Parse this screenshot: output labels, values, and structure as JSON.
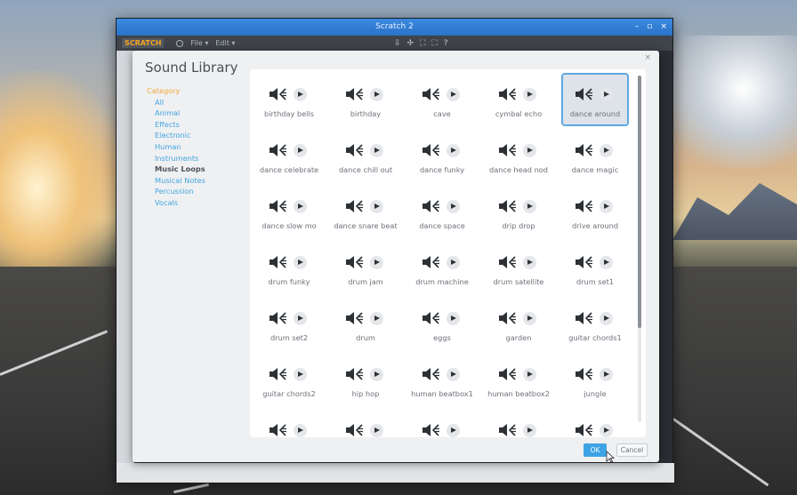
{
  "window": {
    "title": "Scratch 2",
    "controls": [
      "–",
      "▫",
      "×"
    ]
  },
  "menubar": {
    "logo": "SCRATCH",
    "items": [
      "File ▾",
      "Edit ▾"
    ],
    "toolbar_icons": [
      "⇩",
      "✢",
      "⛶",
      "⛶",
      "?"
    ]
  },
  "dialog": {
    "title": "Sound Library",
    "close": "×",
    "category_header": "Category",
    "categories": [
      {
        "label": "All",
        "selected": false
      },
      {
        "label": "Animal",
        "selected": false
      },
      {
        "label": "Effects",
        "selected": false
      },
      {
        "label": "Electronic",
        "selected": false
      },
      {
        "label": "Human",
        "selected": false
      },
      {
        "label": "Instruments",
        "selected": false
      },
      {
        "label": "Music Loops",
        "selected": true
      },
      {
        "label": "Musical Notes",
        "selected": false
      },
      {
        "label": "Percussion",
        "selected": false
      },
      {
        "label": "Vocals",
        "selected": false
      }
    ],
    "sounds": [
      "birthday bells",
      "birthday",
      "cave",
      "cymbal echo",
      "dance around",
      "dance celebrate",
      "dance chill out",
      "dance funky",
      "dance head nod",
      "dance magic",
      "dance slow mo",
      "dance snare beat",
      "dance space",
      "drip drop",
      "drive around",
      "drum funky",
      "drum jam",
      "drum machine",
      "drum satellite",
      "drum set1",
      "drum set2",
      "drum",
      "eggs",
      "garden",
      "guitar chords1",
      "guitar chords2",
      "hip hop",
      "human beatbox1",
      "human beatbox2",
      "jungle",
      "",
      "",
      "",
      "",
      ""
    ],
    "selected_sound": "dance around",
    "ok_label": "OK",
    "cancel_label": "Cancel",
    "scroll_fraction": 0.0
  },
  "colors": {
    "accent": "#3ea3e4",
    "category_link": "#43a6e0",
    "category_header": "#f2a93b",
    "titlebar": "#2a73c9"
  }
}
